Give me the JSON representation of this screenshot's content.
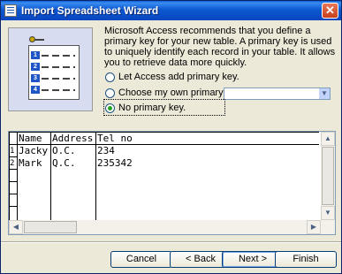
{
  "window": {
    "title": "Import Spreadsheet Wizard",
    "close_glyph": "✕"
  },
  "description": "Microsoft Access recommends that you define a primary key for your new table. A primary key is used to uniquely identify each record in your table. It allows you to retrieve data more quickly.",
  "illustration": {
    "row_numbers": [
      "1",
      "2",
      "3",
      "4"
    ]
  },
  "options": [
    {
      "label": "Let Access add primary key.",
      "selected": false
    },
    {
      "label": "Choose my own primary key.",
      "selected": false
    },
    {
      "label": "No primary key.",
      "selected": true
    }
  ],
  "combo": {
    "value": "",
    "arrow": "▼"
  },
  "grid": {
    "columns": [
      "Name",
      "Address",
      "Tel no"
    ],
    "rows": [
      {
        "num": "1",
        "cells": [
          "Jacky",
          "O.C.",
          "234"
        ]
      },
      {
        "num": "2",
        "cells": [
          "Mark",
          "Q.C.",
          "235342"
        ]
      }
    ]
  },
  "scroll": {
    "up": "▲",
    "down": "▼",
    "left": "◀",
    "right": "▶"
  },
  "buttons": {
    "cancel": "Cancel",
    "back": "< Back",
    "next": "Next >",
    "finish": "Finish"
  }
}
